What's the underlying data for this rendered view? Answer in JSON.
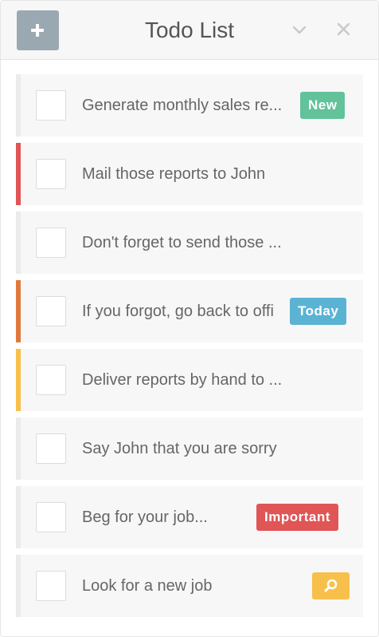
{
  "header": {
    "title": "Todo List",
    "add_icon": "plus-icon",
    "collapse_icon": "chevron-down-icon",
    "close_icon": "close-icon"
  },
  "colors": {
    "add_button": "#9aa9b1",
    "badge_new": "#62c29a",
    "badge_today": "#5bb3d4",
    "badge_important": "#e05555",
    "badge_search": "#f7c04a",
    "stripe_red": "#e05555",
    "stripe_orange": "#e07a3c",
    "stripe_yellow": "#f7c04a"
  },
  "todos": [
    {
      "text": "Generate monthly sales re...",
      "badge": "New"
    },
    {
      "text": "Mail those reports to John"
    },
    {
      "text": "Don't forget to send those ..."
    },
    {
      "text": "If you forgot, go back to offi",
      "badge": "Today"
    },
    {
      "text": "Deliver reports by hand to ..."
    },
    {
      "text": "Say John that you are sorry"
    },
    {
      "text": "Beg for your job...",
      "badge": "Important"
    },
    {
      "text": "Look for a new job",
      "icon": "search-icon"
    }
  ]
}
